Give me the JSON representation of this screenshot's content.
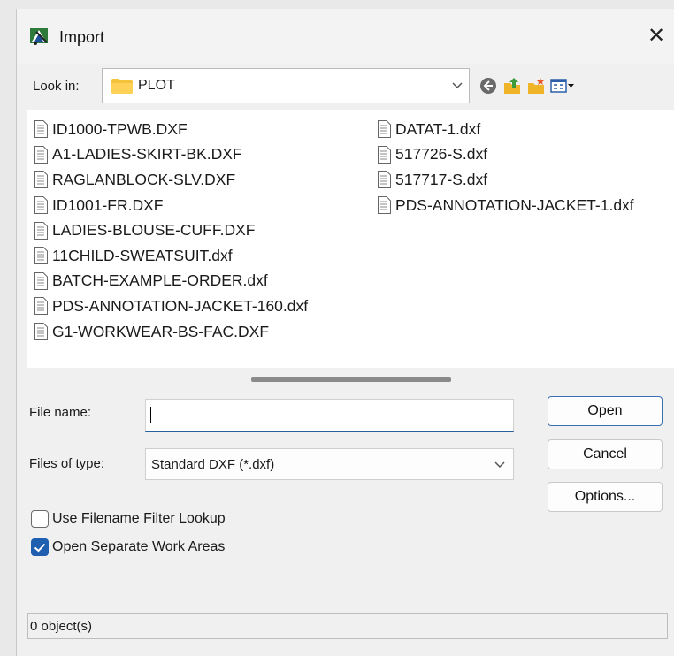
{
  "window": {
    "title": "Import",
    "close_glyph": "✕"
  },
  "toolbar": {
    "lookin_label": "Look in:",
    "lookin_value": "PLOT",
    "icons": [
      "back-icon",
      "up-folder-icon",
      "new-folder-icon",
      "view-menu-icon"
    ]
  },
  "files": {
    "column1": [
      "ID1000-TPWB.DXF",
      "A1-LADIES-SKIRT-BK.DXF",
      "RAGLANBLOCK-SLV.DXF",
      "ID1001-FR.DXF",
      "LADIES-BLOUSE-CUFF.DXF",
      "11CHILD-SWEATSUIT.dxf",
      "BATCH-EXAMPLE-ORDER.dxf",
      "PDS-ANNOTATION-JACKET-160.dxf",
      "G1-WORKWEAR-BS-FAC.DXF"
    ],
    "column2": [
      "DATAT-1.dxf",
      "517726-S.dxf",
      "517717-S.dxf",
      "PDS-ANNOTATION-JACKET-1.dxf"
    ]
  },
  "form": {
    "filename_label": "File name:",
    "filename_value": "",
    "filetype_label": "Files of type:",
    "filetype_value": "Standard DXF (*.dxf)"
  },
  "buttons": {
    "open": "Open",
    "cancel": "Cancel",
    "options": "Options..."
  },
  "checkboxes": {
    "filter_lookup": {
      "label": "Use Filename Filter Lookup",
      "checked": false
    },
    "separate_work_areas": {
      "label": "Open Separate Work Areas",
      "checked": true
    }
  },
  "status": {
    "text": "0 object(s)"
  },
  "colors": {
    "accent": "#1f5fb0",
    "folder": "#f5c33b"
  }
}
